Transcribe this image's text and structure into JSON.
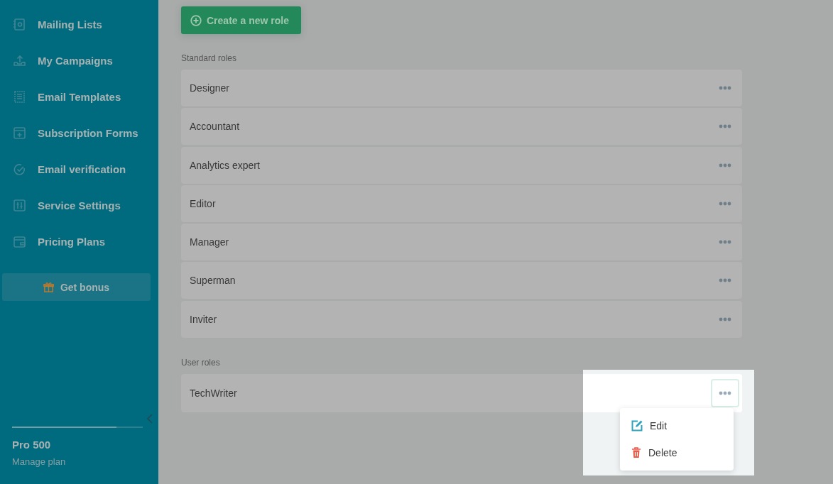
{
  "sidebar": {
    "items": [
      {
        "label": "Mailing Lists"
      },
      {
        "label": "My Campaigns"
      },
      {
        "label": "Email Templates"
      },
      {
        "label": "Subscription Forms"
      },
      {
        "label": "Email verification"
      },
      {
        "label": "Service Settings"
      },
      {
        "label": "Pricing Plans"
      }
    ],
    "bonus_button": "Get bonus",
    "plan": {
      "level": 0.8,
      "name": "Pro 500",
      "link": "Manage plan"
    }
  },
  "main": {
    "create_button": "Create a new role",
    "sections": [
      {
        "title": "Standard roles",
        "roles": [
          {
            "name": "Designer",
            "menu_open": false
          },
          {
            "name": "Accountant",
            "menu_open": false
          },
          {
            "name": "Analytics expert",
            "menu_open": false
          },
          {
            "name": "Editor",
            "menu_open": false
          },
          {
            "name": "Manager",
            "menu_open": false
          },
          {
            "name": "Superman",
            "menu_open": false
          },
          {
            "name": "Inviter",
            "menu_open": false
          }
        ]
      },
      {
        "title": "User roles",
        "roles": [
          {
            "name": "TechWriter",
            "menu_open": true
          }
        ]
      }
    ],
    "menu": [
      {
        "label": "Edit",
        "kind": "edit"
      },
      {
        "label": "Delete",
        "kind": "delete"
      }
    ]
  }
}
